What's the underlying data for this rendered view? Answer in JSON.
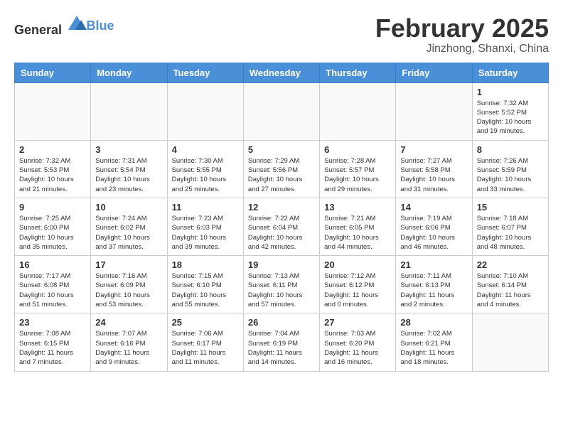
{
  "header": {
    "logo": {
      "text_general": "General",
      "text_blue": "Blue"
    },
    "month": "February 2025",
    "location": "Jinzhong, Shanxi, China"
  },
  "calendar": {
    "weekdays": [
      "Sunday",
      "Monday",
      "Tuesday",
      "Wednesday",
      "Thursday",
      "Friday",
      "Saturday"
    ],
    "weeks": [
      [
        {
          "day": "",
          "info": ""
        },
        {
          "day": "",
          "info": ""
        },
        {
          "day": "",
          "info": ""
        },
        {
          "day": "",
          "info": ""
        },
        {
          "day": "",
          "info": ""
        },
        {
          "day": "",
          "info": ""
        },
        {
          "day": "1",
          "info": "Sunrise: 7:32 AM\nSunset: 5:52 PM\nDaylight: 10 hours\nand 19 minutes."
        }
      ],
      [
        {
          "day": "2",
          "info": "Sunrise: 7:32 AM\nSunset: 5:53 PM\nDaylight: 10 hours\nand 21 minutes."
        },
        {
          "day": "3",
          "info": "Sunrise: 7:31 AM\nSunset: 5:54 PM\nDaylight: 10 hours\nand 23 minutes."
        },
        {
          "day": "4",
          "info": "Sunrise: 7:30 AM\nSunset: 5:55 PM\nDaylight: 10 hours\nand 25 minutes."
        },
        {
          "day": "5",
          "info": "Sunrise: 7:29 AM\nSunset: 5:56 PM\nDaylight: 10 hours\nand 27 minutes."
        },
        {
          "day": "6",
          "info": "Sunrise: 7:28 AM\nSunset: 5:57 PM\nDaylight: 10 hours\nand 29 minutes."
        },
        {
          "day": "7",
          "info": "Sunrise: 7:27 AM\nSunset: 5:58 PM\nDaylight: 10 hours\nand 31 minutes."
        },
        {
          "day": "8",
          "info": "Sunrise: 7:26 AM\nSunset: 5:59 PM\nDaylight: 10 hours\nand 33 minutes."
        }
      ],
      [
        {
          "day": "9",
          "info": "Sunrise: 7:25 AM\nSunset: 6:00 PM\nDaylight: 10 hours\nand 35 minutes."
        },
        {
          "day": "10",
          "info": "Sunrise: 7:24 AM\nSunset: 6:02 PM\nDaylight: 10 hours\nand 37 minutes."
        },
        {
          "day": "11",
          "info": "Sunrise: 7:23 AM\nSunset: 6:03 PM\nDaylight: 10 hours\nand 39 minutes."
        },
        {
          "day": "12",
          "info": "Sunrise: 7:22 AM\nSunset: 6:04 PM\nDaylight: 10 hours\nand 42 minutes."
        },
        {
          "day": "13",
          "info": "Sunrise: 7:21 AM\nSunset: 6:05 PM\nDaylight: 10 hours\nand 44 minutes."
        },
        {
          "day": "14",
          "info": "Sunrise: 7:19 AM\nSunset: 6:06 PM\nDaylight: 10 hours\nand 46 minutes."
        },
        {
          "day": "15",
          "info": "Sunrise: 7:18 AM\nSunset: 6:07 PM\nDaylight: 10 hours\nand 48 minutes."
        }
      ],
      [
        {
          "day": "16",
          "info": "Sunrise: 7:17 AM\nSunset: 6:08 PM\nDaylight: 10 hours\nand 51 minutes."
        },
        {
          "day": "17",
          "info": "Sunrise: 7:16 AM\nSunset: 6:09 PM\nDaylight: 10 hours\nand 53 minutes."
        },
        {
          "day": "18",
          "info": "Sunrise: 7:15 AM\nSunset: 6:10 PM\nDaylight: 10 hours\nand 55 minutes."
        },
        {
          "day": "19",
          "info": "Sunrise: 7:13 AM\nSunset: 6:11 PM\nDaylight: 10 hours\nand 57 minutes."
        },
        {
          "day": "20",
          "info": "Sunrise: 7:12 AM\nSunset: 6:12 PM\nDaylight: 11 hours\nand 0 minutes."
        },
        {
          "day": "21",
          "info": "Sunrise: 7:11 AM\nSunset: 6:13 PM\nDaylight: 11 hours\nand 2 minutes."
        },
        {
          "day": "22",
          "info": "Sunrise: 7:10 AM\nSunset: 6:14 PM\nDaylight: 11 hours\nand 4 minutes."
        }
      ],
      [
        {
          "day": "23",
          "info": "Sunrise: 7:08 AM\nSunset: 6:15 PM\nDaylight: 11 hours\nand 7 minutes."
        },
        {
          "day": "24",
          "info": "Sunrise: 7:07 AM\nSunset: 6:16 PM\nDaylight: 11 hours\nand 9 minutes."
        },
        {
          "day": "25",
          "info": "Sunrise: 7:06 AM\nSunset: 6:17 PM\nDaylight: 11 hours\nand 11 minutes."
        },
        {
          "day": "26",
          "info": "Sunrise: 7:04 AM\nSunset: 6:19 PM\nDaylight: 11 hours\nand 14 minutes."
        },
        {
          "day": "27",
          "info": "Sunrise: 7:03 AM\nSunset: 6:20 PM\nDaylight: 11 hours\nand 16 minutes."
        },
        {
          "day": "28",
          "info": "Sunrise: 7:02 AM\nSunset: 6:21 PM\nDaylight: 11 hours\nand 18 minutes."
        },
        {
          "day": "",
          "info": ""
        }
      ]
    ]
  }
}
